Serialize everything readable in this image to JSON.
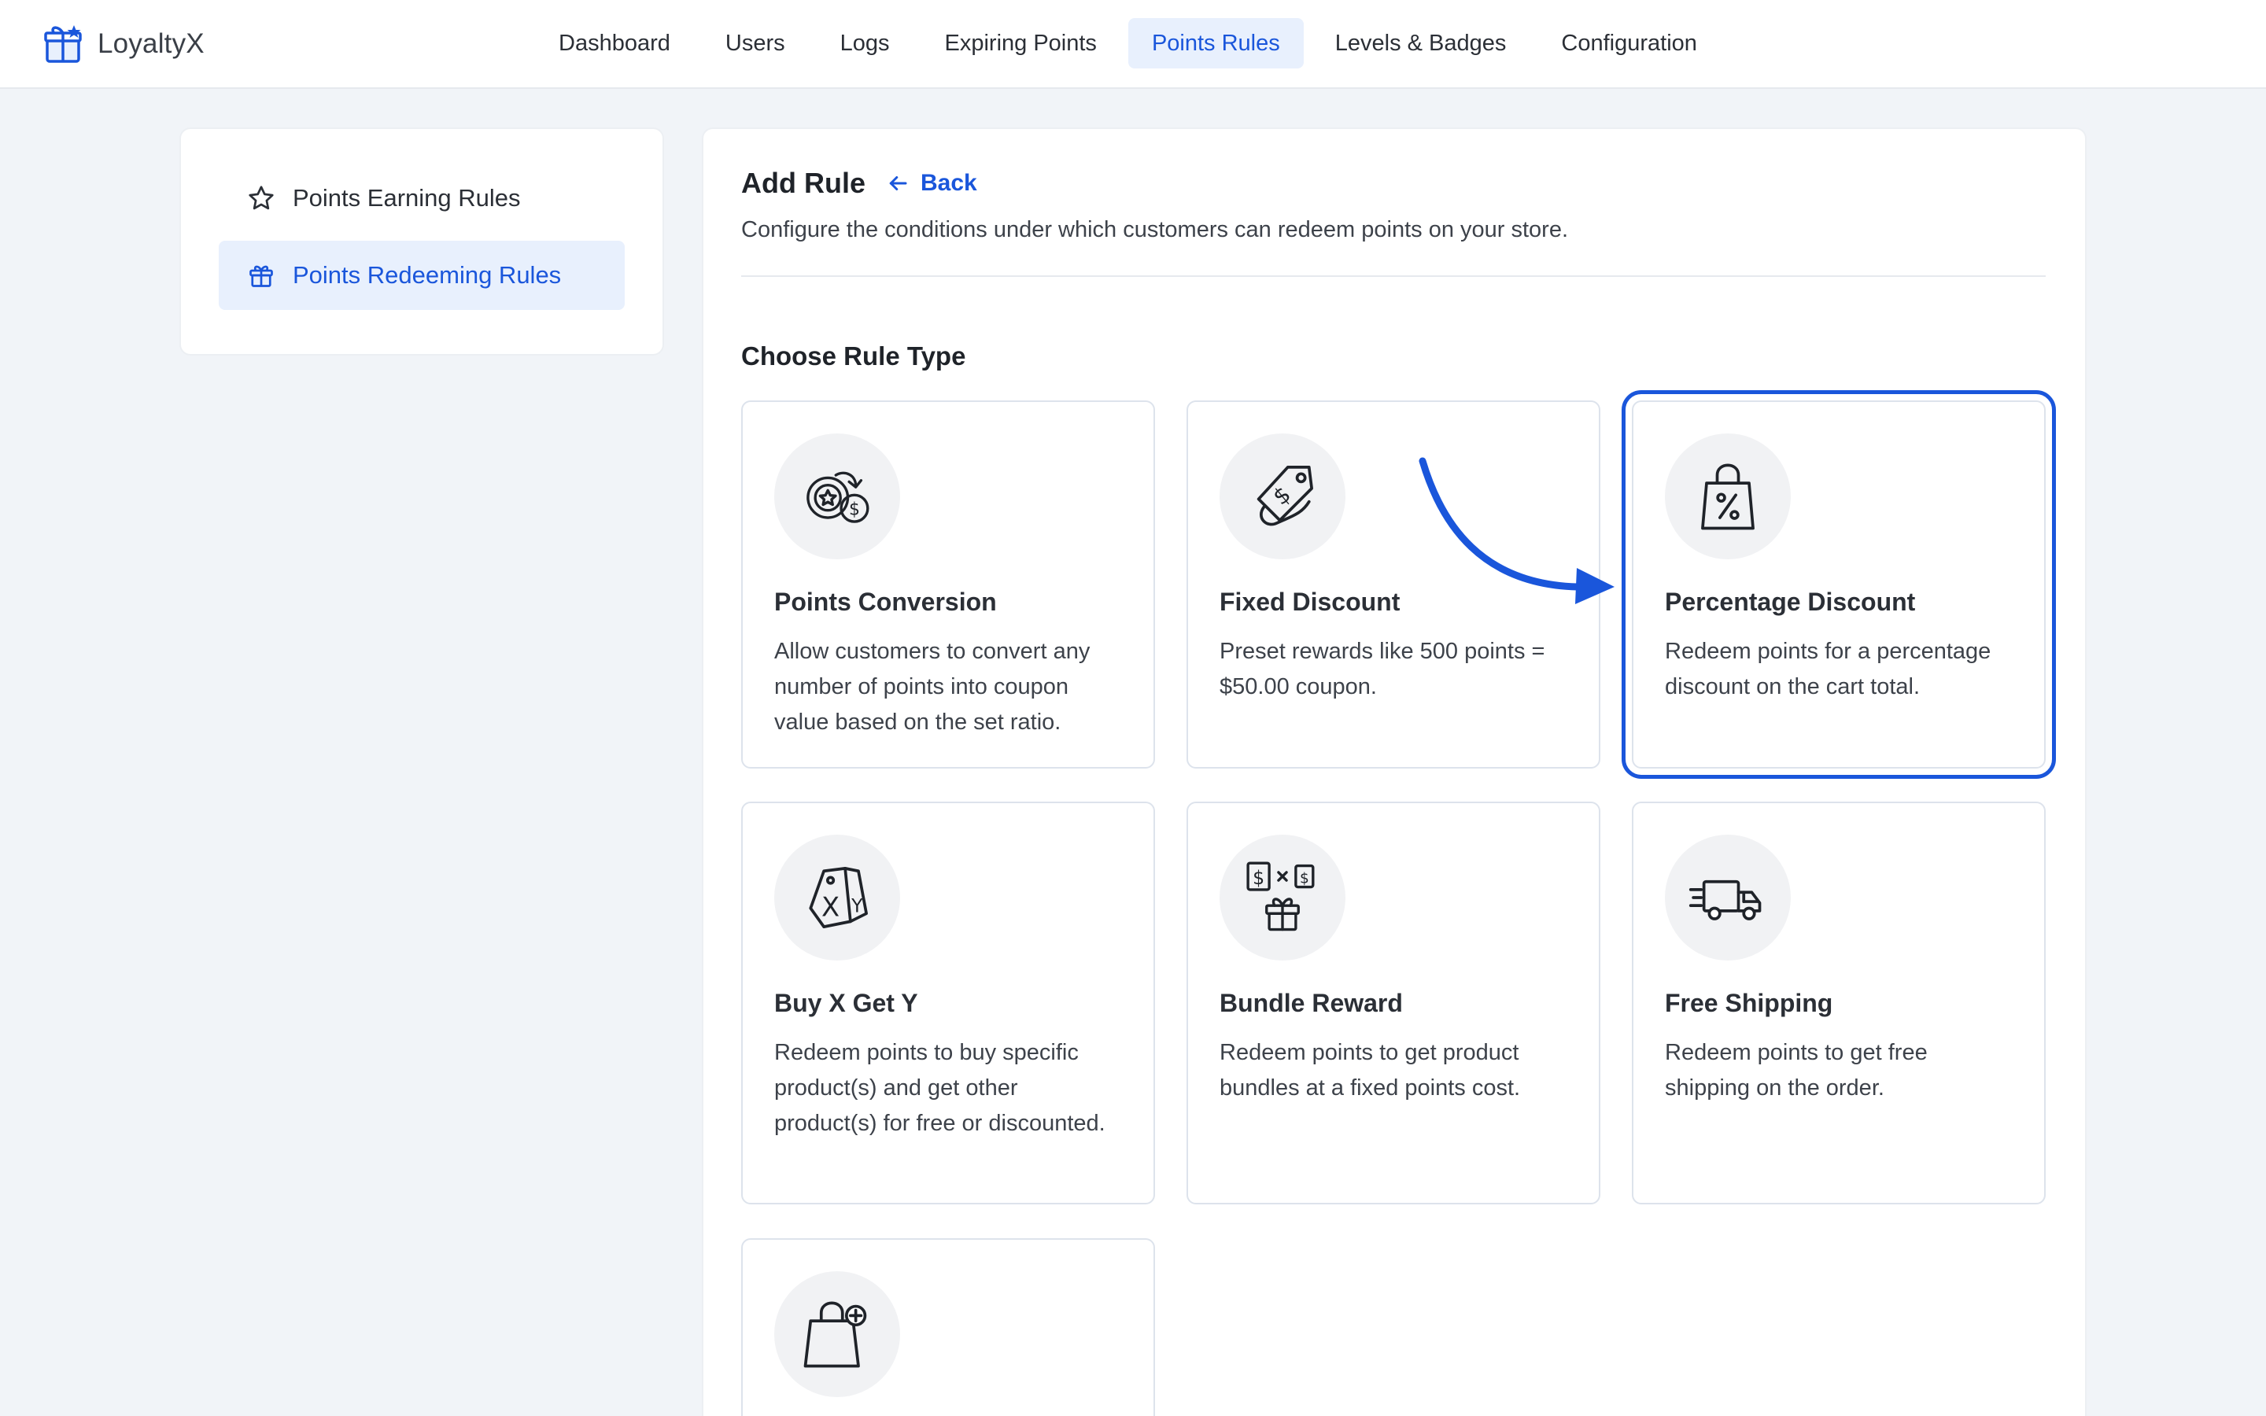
{
  "app": {
    "name": "LoyaltyX",
    "logo_icon": "gift-box-icon"
  },
  "nav": {
    "items": [
      {
        "label": "Dashboard",
        "active": false
      },
      {
        "label": "Users",
        "active": false
      },
      {
        "label": "Logs",
        "active": false
      },
      {
        "label": "Expiring Points",
        "active": false
      },
      {
        "label": "Points Rules",
        "active": true
      },
      {
        "label": "Levels & Badges",
        "active": false
      },
      {
        "label": "Configuration",
        "active": false
      }
    ]
  },
  "sidebar": {
    "items": [
      {
        "label": "Points Earning Rules",
        "icon": "star-icon",
        "active": false
      },
      {
        "label": "Points Redeeming Rules",
        "icon": "gift-icon",
        "active": true
      }
    ]
  },
  "main": {
    "title": "Add Rule",
    "back_label": "Back",
    "description": "Configure the conditions under which customers can redeem points on your store.",
    "section_title": "Choose Rule Type",
    "cards": [
      {
        "title": "Points Conversion",
        "icon": "coin-exchange-icon",
        "description": "Allow customers to convert any number of points into coupon value based on the set ratio.",
        "selected": false
      },
      {
        "title": "Fixed Discount",
        "icon": "price-tag-icon",
        "description": "Preset rewards like 500 points = $50.00 coupon.",
        "selected": false
      },
      {
        "title": "Percentage Discount",
        "icon": "shopping-bag-percent-icon",
        "description": "Redeem points for a percentage discount on the cart total.",
        "selected": true
      },
      {
        "title": "Buy X Get Y",
        "icon": "xy-tags-icon",
        "description": "Redeem points to buy specific product(s) and get other product(s) for free or discounted.",
        "selected": false
      },
      {
        "title": "Bundle Reward",
        "icon": "bundle-gift-icon",
        "description": "Redeem points to get product bundles at a fixed points cost.",
        "selected": false
      },
      {
        "title": "Free Shipping",
        "icon": "delivery-truck-icon",
        "description": "Redeem points to get free shipping on the order.",
        "selected": false
      },
      {
        "icon": "shopping-bag-plus-icon",
        "selected": false
      }
    ]
  },
  "colors": {
    "accent": "#1a56db",
    "accent_bg": "#e8f0fd",
    "page_bg": "#f1f4f8"
  }
}
